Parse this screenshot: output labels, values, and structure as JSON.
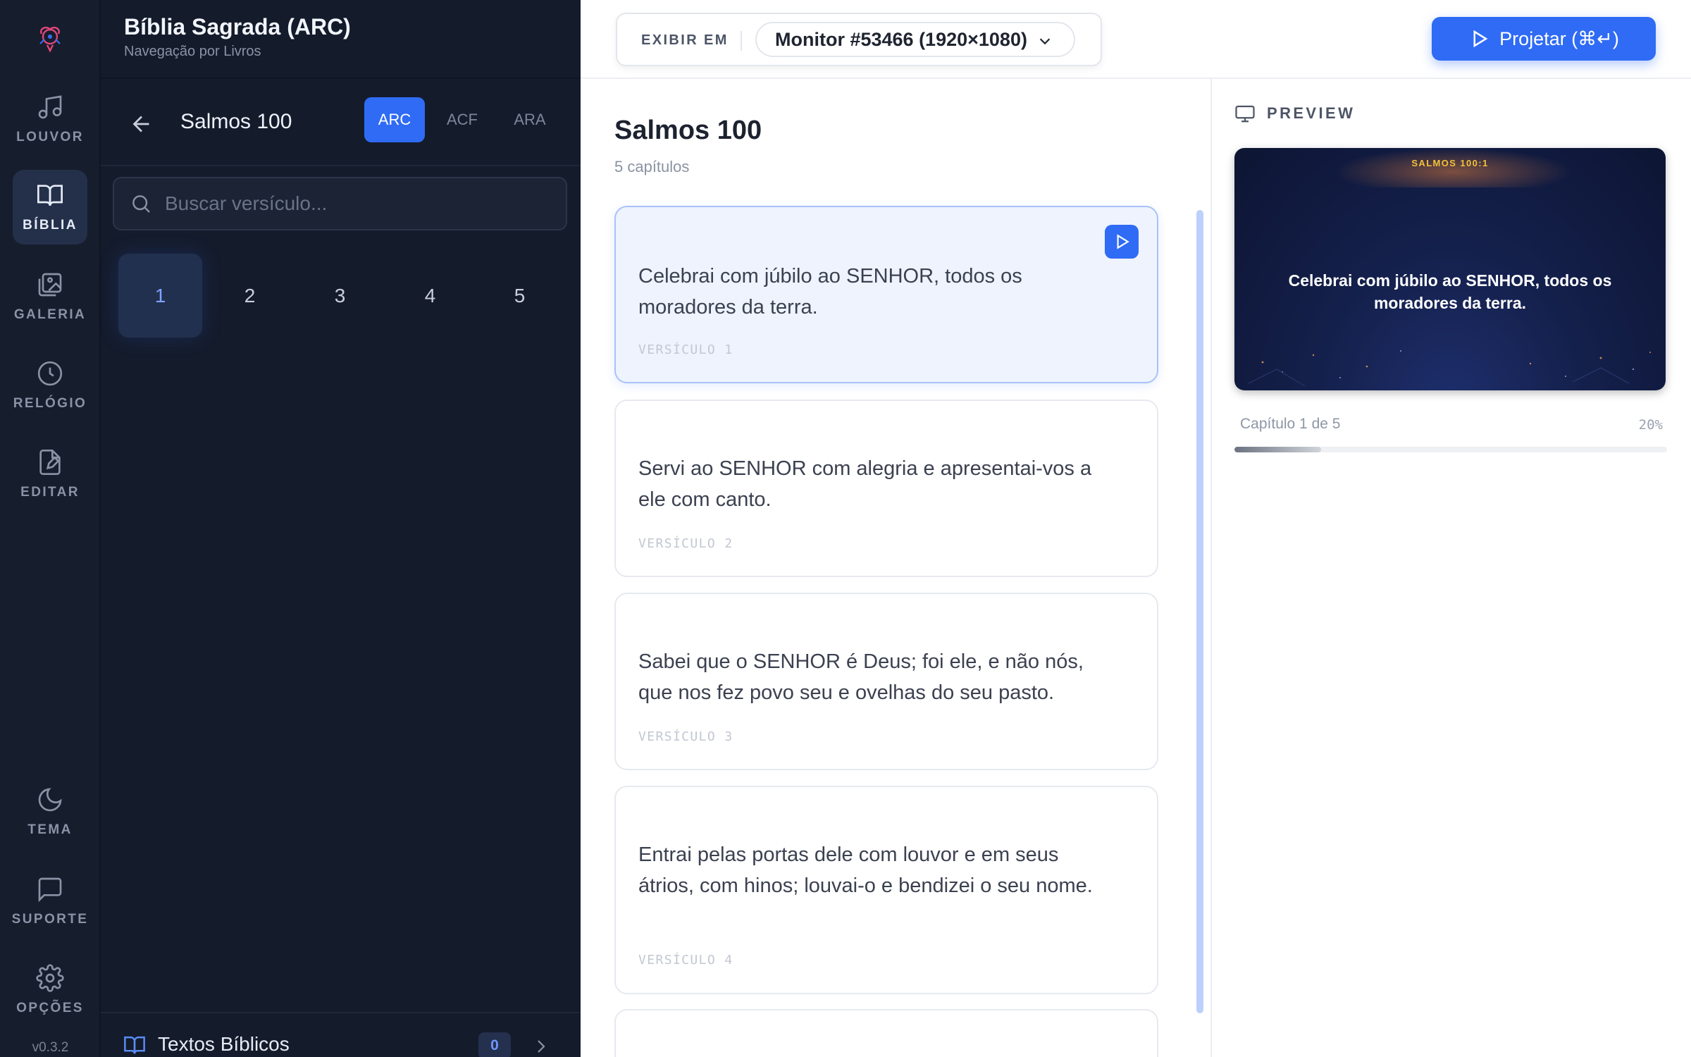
{
  "rail": {
    "items": [
      {
        "label": "LOUVOR",
        "icon": "music-icon"
      },
      {
        "label": "BÍBLIA",
        "icon": "book-open-icon"
      },
      {
        "label": "GALERIA",
        "icon": "gallery-icon"
      },
      {
        "label": "RELÓGIO",
        "icon": "clock-icon"
      },
      {
        "label": "EDITAR",
        "icon": "edit-icon"
      },
      {
        "label": "TEMA",
        "icon": "moon-icon"
      },
      {
        "label": "SUPORTE",
        "icon": "message-icon"
      },
      {
        "label": "OPÇÕES",
        "icon": "gear-icon"
      }
    ],
    "active_index": 1,
    "version": "v0.3.2"
  },
  "nav": {
    "title": "Bíblia Sagrada (ARC)",
    "subtitle": "Navegação por Livros",
    "book": "Salmos 100",
    "versions": [
      "ARC",
      "ACF",
      "ARA"
    ],
    "active_version": "ARC",
    "search_placeholder": "Buscar versículo...",
    "chapters": [
      "1",
      "2",
      "3",
      "4",
      "5"
    ],
    "active_chapter": "1",
    "footer": {
      "label": "Textos Bíblicos",
      "count": "0"
    }
  },
  "topbar": {
    "display_label": "EXIBIR EM",
    "monitor": "Monitor #53466 (1920×1080)",
    "project_label": "Projetar (⌘↵)"
  },
  "verses": {
    "title": "Salmos 100",
    "subtitle": "5 capítulos",
    "items": [
      {
        "text": "Celebrai com júbilo ao SENHOR, todos os moradores da terra.",
        "label": "VERSÍCULO 1",
        "active": true
      },
      {
        "text": "Servi ao SENHOR com alegria e apresentai-vos a ele com canto.",
        "label": "VERSÍCULO 2"
      },
      {
        "text": "Sabei que o SENHOR é Deus; foi ele, e não nós, que nos fez povo seu e ovelhas do seu pasto.",
        "label": "VERSÍCULO 3"
      },
      {
        "text": "Entrai pelas portas dele com louvor e em seus átrios, com hinos; louvai-o e bendizei o seu nome.",
        "label": "VERSÍCULO 4"
      }
    ]
  },
  "preview": {
    "label": "PREVIEW",
    "reference": "SALMOS 100:1",
    "text": "Celebrai com júbilo ao SENHOR, todos os moradores da terra.",
    "progress_label": "Capítulo 1 de 5",
    "progress_pct": "20%",
    "progress_value": 0.2
  },
  "colors": {
    "accent": "#2f6bf5",
    "rail_bg": "#161d2c",
    "nav_bg": "#141b2b",
    "verse_active_bg": "#eef3fe",
    "preview_ref": "#f3c23a"
  }
}
